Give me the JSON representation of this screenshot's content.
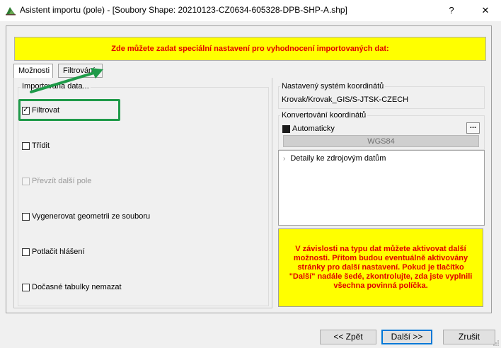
{
  "window": {
    "title": "Asistent importu (pole) - [Soubory Shape: 20210123-CZ0634-605328-DPB-SHP-A.shp]",
    "help_label": "?",
    "close_label": "✕"
  },
  "banner": {
    "text": "Zde můžete zadat speciální nastavení pro vyhodnocení importovaných dat:"
  },
  "tabs": [
    {
      "label": "Možnosti",
      "active": true
    },
    {
      "label": "Filtrování",
      "active": false
    }
  ],
  "imported_data": {
    "group_label": "Importovaná data...",
    "options": [
      {
        "label": "Filtrovat",
        "checked": true,
        "disabled": false
      },
      {
        "label": "Třídit",
        "checked": false,
        "disabled": false
      },
      {
        "label": "Převzít další pole",
        "checked": false,
        "disabled": true
      },
      {
        "label": "Vygenerovat geometrii ze souboru",
        "checked": false,
        "disabled": false
      },
      {
        "label": "Potlačit hlášení",
        "checked": false,
        "disabled": false
      },
      {
        "label": "Dočasné tabulky nemazat",
        "checked": false,
        "disabled": false
      }
    ]
  },
  "coordinate_system": {
    "label": "Nastavený systém koordinátů",
    "value": "Krovak/Krovak_GIS/S-JTSK-CZECH"
  },
  "conversion": {
    "label": "Konvertování koordinátů",
    "automatic_label": "Automaticky",
    "automatic_checked": true,
    "dots_label": "...",
    "wgs_button_label": "WGS84"
  },
  "tree": {
    "item_label": "Detaily ke zdrojovým datům"
  },
  "note": {
    "text": "V závislosti na typu dat můžete aktivovat další možnosti. Přitom budou eventuálně aktivovány stránky pro další nastavení. Pokud je tlačítko \"Další\" nadále šedé, zkontrolujte, zda jste vyplnili všechna povinná políčka."
  },
  "buttons": {
    "back": "<< Zpět",
    "next": "Další >>",
    "cancel": "Zrušit"
  },
  "colors": {
    "banner_bg": "#ffff00",
    "banner_text": "#e00000",
    "highlight": "#1f9a49"
  }
}
